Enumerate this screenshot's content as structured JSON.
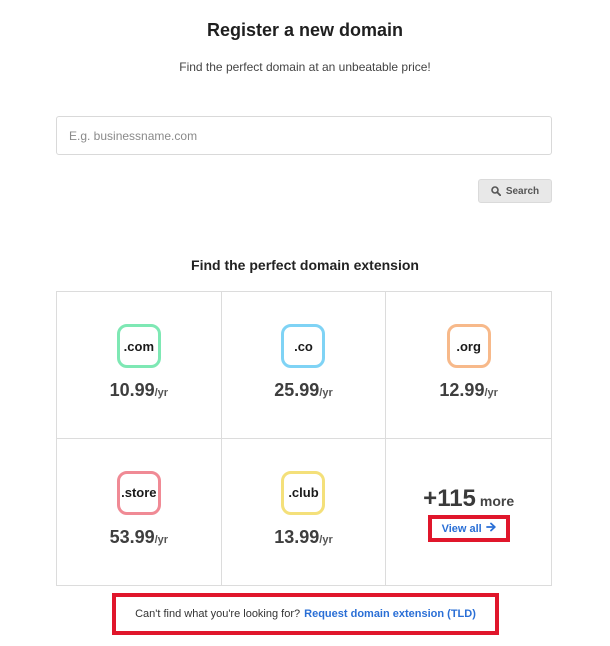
{
  "header": {
    "title": "Register a new domain",
    "subtitle": "Find the perfect domain at an unbeatable price!"
  },
  "search": {
    "placeholder": "E.g. businessname.com",
    "value": "",
    "button_label": "Search"
  },
  "extensions_section": {
    "title": "Find the perfect domain extension",
    "items": [
      {
        "ext": ".com",
        "price": "10.99",
        "unit": "/yr",
        "border_color": "#7ee8b4"
      },
      {
        "ext": ".co",
        "price": "25.99",
        "unit": "/yr",
        "border_color": "#7fd3f5"
      },
      {
        "ext": ".org",
        "price": "12.99",
        "unit": "/yr",
        "border_color": "#f7b98a"
      },
      {
        "ext": ".store",
        "price": "53.99",
        "unit": "/yr",
        "border_color": "#f08a95"
      },
      {
        "ext": ".club",
        "price": "13.99",
        "unit": "/yr",
        "border_color": "#f4e07a"
      }
    ],
    "more": {
      "count": "+115",
      "label": "more",
      "view_all_label": "View all"
    }
  },
  "footer": {
    "prompt_text": "Can't find what you're looking for?",
    "request_link": "Request domain extension (TLD)"
  },
  "colors": {
    "link": "#2a6fd6",
    "highlight": "#e0162b"
  },
  "icons": {
    "search": "search-icon",
    "view_all_arrow": "arrow-right-icon"
  }
}
